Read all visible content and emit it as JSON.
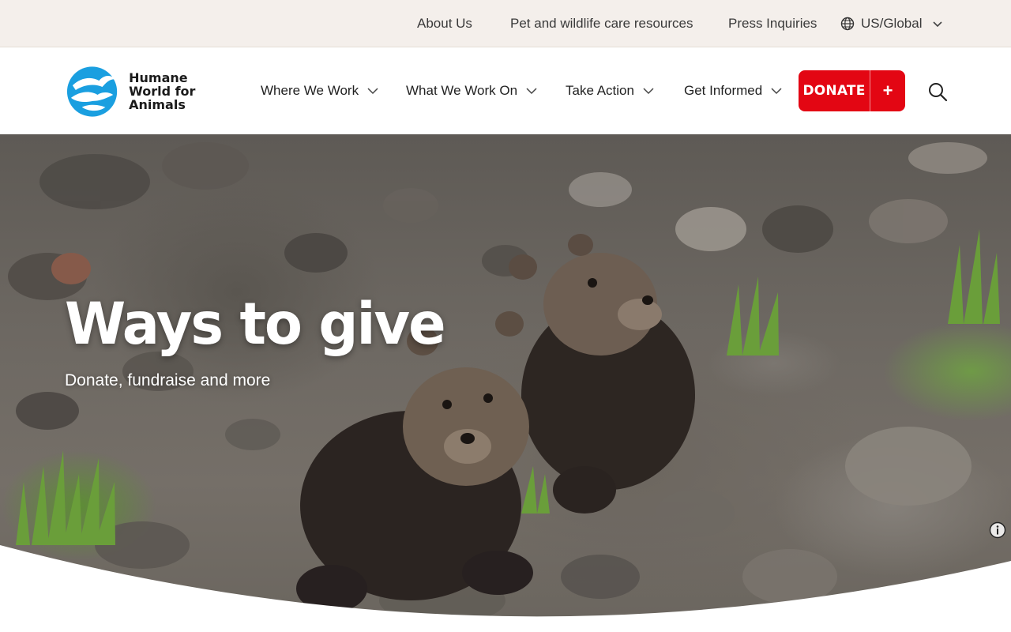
{
  "utility_nav": {
    "about": "About Us",
    "resources": "Pet and wildlife care resources",
    "press": "Press Inquiries",
    "locale": "US/Global"
  },
  "brand": {
    "name_line1": "Humane",
    "name_line2": "World for",
    "name_line3": "Animals",
    "color": "#1a9fe0"
  },
  "main_nav": {
    "items": [
      {
        "label": "Where We Work"
      },
      {
        "label": "What We Work On"
      },
      {
        "label": "Take Action"
      },
      {
        "label": "Get Informed"
      }
    ],
    "donate_label": "DONATE",
    "donate_plus": "+",
    "donate_color": "#e30613"
  },
  "hero": {
    "title": "Ways to give",
    "subtitle": "Donate, fundraise and more"
  },
  "icons": [
    "globe-icon",
    "chevron-down-icon",
    "search-icon",
    "info-icon",
    "plus-icon"
  ]
}
